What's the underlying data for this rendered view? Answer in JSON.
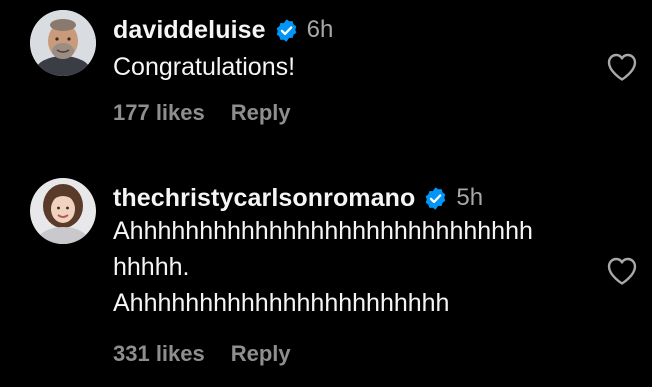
{
  "colors": {
    "background": "#000000",
    "text_primary": "#f5f5f5",
    "text_secondary": "#a8a8a8",
    "meta": "#8e8e8e",
    "verified_blue": "#0095f6",
    "heart_outline": "#a8a8a8"
  },
  "comments": [
    {
      "username": "daviddeluise",
      "verified_icon": "verified-badge-icon",
      "time": "6h",
      "text": "Congratulations!",
      "likes": "177 likes",
      "reply_label": "Reply",
      "like_icon": "heart-outline-icon",
      "avatar_icon": "profile-photo"
    },
    {
      "username": "thechristycarlsonromano",
      "verified_icon": "verified-badge-icon",
      "time": "5h",
      "text": "Ahhhhhhhhhhhhhhhhhhhhhhhhhhhhh\nhhhhh.\nAhhhhhhhhhhhhhhhhhhhhhhh",
      "likes": "331 likes",
      "reply_label": "Reply",
      "like_icon": "heart-outline-icon",
      "avatar_icon": "profile-photo"
    }
  ]
}
